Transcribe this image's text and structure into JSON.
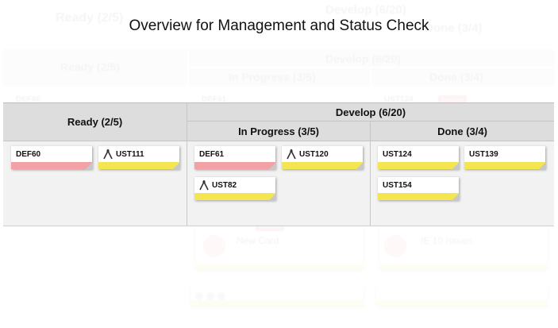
{
  "title": "Overview for Management and Status Check",
  "background": {
    "ready_header": "Ready (2/5)",
    "develop_header": "Develop (6/20)",
    "done_header": "Done (3/4)",
    "in_progress_header": "In Progress (3/5)",
    "top_ready": "Ready (2/5)",
    "top_develop": "Develop (6/20)",
    "top_done": "Done (3/4)",
    "card_def60": "DEF60",
    "card_def61": "DEF61",
    "card_ust124": "UST124",
    "blocked_label": "Blocked",
    "new_card": "New Card",
    "ie_issue": "IE 10 issues"
  },
  "board": {
    "ready": {
      "header": "Ready (2/5)",
      "cards": [
        {
          "id": "DEF60",
          "stripe": "red",
          "icon": "none"
        },
        {
          "id": "UST111",
          "stripe": "yellow",
          "icon": "fork"
        }
      ]
    },
    "develop": {
      "header": "Develop (6/20)",
      "in_progress": {
        "header": "In Progress (3/5)",
        "cards": [
          {
            "id": "DEF61",
            "stripe": "red",
            "icon": "none"
          },
          {
            "id": "UST120",
            "stripe": "yellow",
            "icon": "fork"
          },
          {
            "id": "UST82",
            "stripe": "yellow",
            "icon": "fork"
          }
        ]
      },
      "done": {
        "header": "Done (3/4)",
        "cards": [
          {
            "id": "UST124",
            "stripe": "yellow",
            "icon": "none"
          },
          {
            "id": "UST139",
            "stripe": "yellow",
            "icon": "none"
          },
          {
            "id": "UST154",
            "stripe": "yellow",
            "icon": "none"
          }
        ]
      }
    }
  },
  "colors": {
    "stripe_yellow": "#f3e650",
    "stripe_red": "#f2a2a6",
    "header_gray": "#dddddd",
    "board_gray": "#f2f2f2"
  }
}
